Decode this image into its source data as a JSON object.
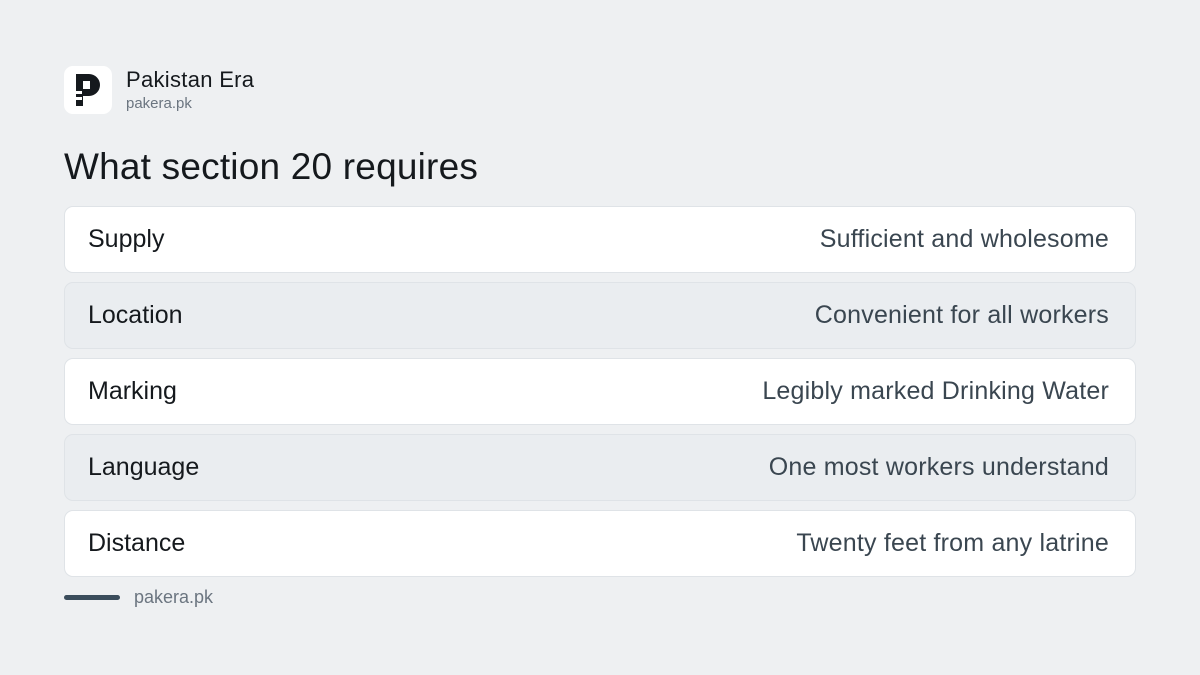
{
  "brand": {
    "name": "Pakistan Era",
    "url": "pakera.pk"
  },
  "title": "What section 20 requires",
  "rows": [
    {
      "label": "Supply",
      "value": "Sufficient and wholesome"
    },
    {
      "label": "Location",
      "value": "Convenient for all workers"
    },
    {
      "label": "Marking",
      "value": "Legibly marked Drinking Water"
    },
    {
      "label": "Language",
      "value": "One most workers understand"
    },
    {
      "label": "Distance",
      "value": "Twenty feet from any latrine"
    }
  ],
  "footer": {
    "text": "pakera.pk"
  },
  "colors": {
    "background": "#eef0f2",
    "accent_bar": "#3b4d5c",
    "logo": "#15191d"
  },
  "icons": {
    "logo": "pakistan-era-logo-icon"
  }
}
